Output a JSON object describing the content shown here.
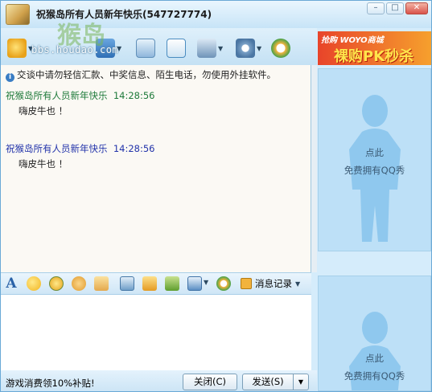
{
  "window": {
    "title": "祝猴岛所有人员新年快乐(547727774)"
  },
  "watermark": {
    "logo": "猴岛",
    "url": "bbs.houdao.com"
  },
  "ad": {
    "top": "抢购 WOYO商城",
    "main": "裸购PK秒杀"
  },
  "notice": "交谈中请勿轻信汇款、中奖信息、陌生电话，勿使用外挂软件。",
  "messages": [
    {
      "sender": "祝猴岛所有人员新年快乐",
      "time": "14:28:56",
      "text": "嗨皮牛也 ！",
      "color": "#1e7a3a"
    },
    {
      "sender": "祝猴岛所有人员新年快乐",
      "time": "14:28:56",
      "text": "嗨皮牛也 ！",
      "color": "#2233aa"
    }
  ],
  "history_label": "消息记录",
  "bottom": {
    "ad_text": "游戏消费领10%补贴!",
    "close_label": "关闭(C)",
    "send_label": "发送(S)"
  },
  "show": {
    "line1": "点此",
    "line2": "免费拥有QQ秀"
  },
  "colors": {
    "accent": "#3a7dc4",
    "panel": "#bde0f7"
  }
}
